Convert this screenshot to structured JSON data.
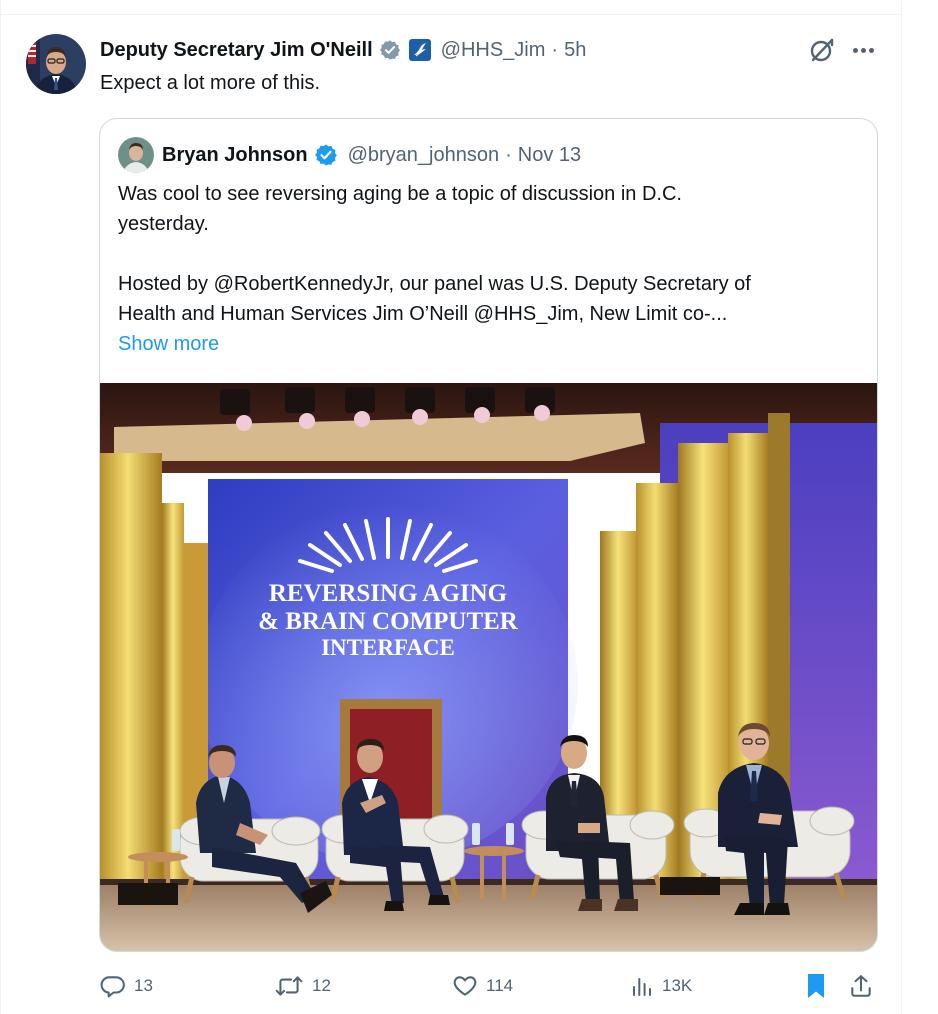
{
  "tweet": {
    "author_name": "Deputy Secretary Jim O'Neill",
    "handle": "@HHS_Jim",
    "separator": "·",
    "time": "5h",
    "text": "Expect a lot more of this."
  },
  "quoted_tweet": {
    "author_name": "Bryan Johnson",
    "handle": "@bryan_johnson",
    "separator": "·",
    "date": "Nov 13",
    "line1": "Was cool to see reversing aging be a topic of discussion in D.C.",
    "line2": "yesterday.",
    "line3": "Hosted by @RobertKennedyJr, our panel was U.S. Deputy Secretary of",
    "line4": "Health and Human Services Jim O’Neill @HHS_Jim, New Limit co-...",
    "show_more": "Show more",
    "image": {
      "screen_title_line1": "REVERSING AGING",
      "screen_title_line2": "& BRAIN COMPUTER",
      "screen_title_line3": "INTERFACE"
    }
  },
  "actions": {
    "replies": "13",
    "reposts": "12",
    "likes": "114",
    "views": "13K"
  },
  "icons": {
    "author_verified": "grey-verified-check-icon",
    "government_badge": "hhs-eagle-badge-icon",
    "quoted_verified": "blue-verified-check-icon",
    "grok": "grok-icon",
    "more": "more-dots-icon",
    "reply": "reply-icon",
    "repost": "repost-icon",
    "like": "heart-icon",
    "views": "views-bar-icon",
    "bookmark": "bookmark-icon",
    "share": "share-icon"
  },
  "colors": {
    "link_blue": "#1d9bf0",
    "text_primary": "#0f1419",
    "text_secondary": "#536471",
    "border": "#cfd9de",
    "verified_grey": "#829aab"
  }
}
